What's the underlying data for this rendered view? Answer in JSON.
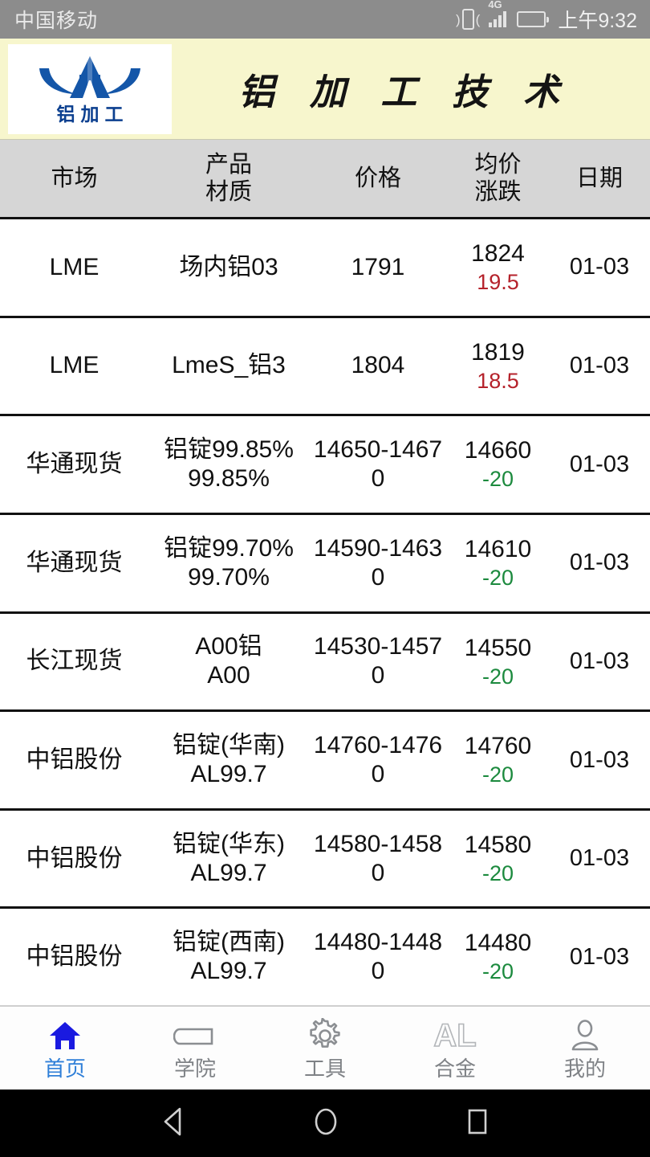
{
  "status_bar": {
    "carrier": "中国移动",
    "network": "4G",
    "time": "上午9:32",
    "icons": [
      "vibrate-icon",
      "signal-icon",
      "battery-icon"
    ]
  },
  "banner": {
    "logo_text": "铝加工",
    "title": "铝 加 工 技 术"
  },
  "table": {
    "headers": {
      "market": "市场",
      "product_line1": "产品",
      "product_line2": "材质",
      "price": "价格",
      "avg_line1": "均价",
      "avg_line2": "涨跌",
      "date": "日期"
    },
    "rows": [
      {
        "market": "LME",
        "product": "场内铝03",
        "material": "",
        "price": "1791",
        "avg": "1824",
        "change": "19.5",
        "dir": "up",
        "date": "01-03"
      },
      {
        "market": "LME",
        "product": "LmeS_铝3",
        "material": "",
        "price": "1804",
        "avg": "1819",
        "change": "18.5",
        "dir": "up",
        "date": "01-03"
      },
      {
        "market": "华通现货",
        "product": "铝锭99.85%",
        "material": "99.85%",
        "price": "14650-14670",
        "avg": "14660",
        "change": "-20",
        "dir": "down",
        "date": "01-03"
      },
      {
        "market": "华通现货",
        "product": "铝锭99.70%",
        "material": "99.70%",
        "price": "14590-14630",
        "avg": "14610",
        "change": "-20",
        "dir": "down",
        "date": "01-03"
      },
      {
        "market": "长江现货",
        "product": "A00铝",
        "material": "A00",
        "price": "14530-14570",
        "avg": "14550",
        "change": "-20",
        "dir": "down",
        "date": "01-03"
      },
      {
        "market": "中铝股份",
        "product": "铝锭(华南)",
        "material": "AL99.7",
        "price": "14760-14760",
        "avg": "14760",
        "change": "-20",
        "dir": "down",
        "date": "01-03"
      },
      {
        "market": "中铝股份",
        "product": "铝锭(华东)",
        "material": "AL99.7",
        "price": "14580-14580",
        "avg": "14580",
        "change": "-20",
        "dir": "down",
        "date": "01-03"
      },
      {
        "market": "中铝股份",
        "product": "铝锭(西南)",
        "material": "AL99.7",
        "price": "14480-14480",
        "avg": "14480",
        "change": "-20",
        "dir": "down",
        "date": "01-03"
      }
    ]
  },
  "tabbar": {
    "items": [
      {
        "label": "首页",
        "icon": "home-icon",
        "active": true
      },
      {
        "label": "学院",
        "icon": "book-icon",
        "active": false
      },
      {
        "label": "工具",
        "icon": "gear-icon",
        "active": false
      },
      {
        "label": "合金",
        "icon": "al-icon",
        "glyph": "AL",
        "active": false
      },
      {
        "label": "我的",
        "icon": "person-icon",
        "active": false
      }
    ]
  },
  "android_nav": {
    "buttons": [
      "back-icon",
      "home-icon",
      "recents-icon"
    ]
  },
  "colors": {
    "status_bar_bg": "#8c8c8c",
    "banner_bg": "#f7f6cd",
    "header_bg": "#d6d6d6",
    "up": "#b5222b",
    "down": "#1c8a3e",
    "accent": "#2f7fd8",
    "logo_blue": "#0b3f8f"
  }
}
